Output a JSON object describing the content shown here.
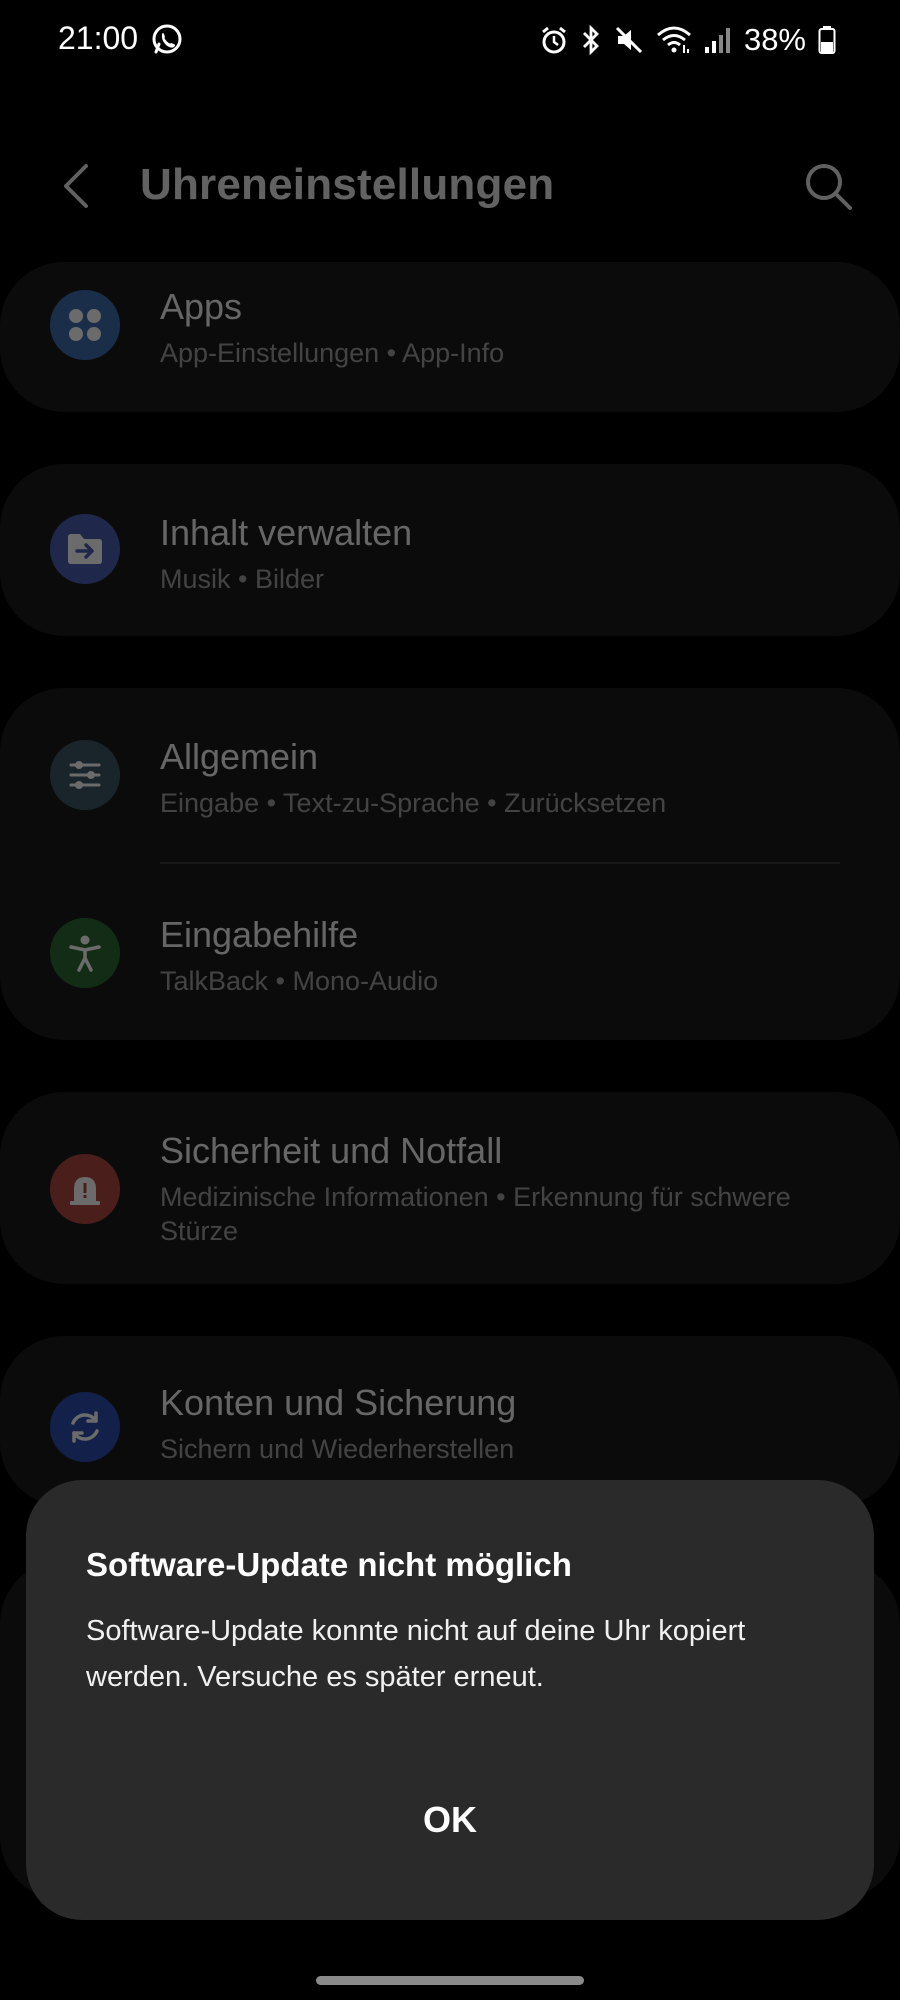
{
  "status_bar": {
    "time": "21:00",
    "battery": "38%",
    "icons": [
      "whatsapp-icon",
      "alarm-icon",
      "bluetooth-icon",
      "mute-icon",
      "wifi-icon",
      "signal-icon",
      "battery-icon"
    ]
  },
  "app_bar": {
    "title": "Uhreneinstellungen",
    "back_icon": "back-arrow-icon",
    "search_icon": "search-icon"
  },
  "settings": [
    {
      "title": "Apps",
      "subtitle": "App-Einstellungen • App-Info",
      "icon": "apps-grid-icon",
      "color": "#3f6fb0"
    },
    {
      "title": "Inhalt verwalten",
      "subtitle": "Musik • Bilder",
      "icon": "folder-transfer-icon",
      "color": "#4a60b0"
    },
    {
      "title": "Allgemein",
      "subtitle": "Eingabe • Text-zu-Sprache • Zurücksetzen",
      "icon": "sliders-icon",
      "color": "#3f5a66"
    },
    {
      "title": "Eingabehilfe",
      "subtitle": "TalkBack • Mono-Audio",
      "icon": "accessibility-icon",
      "color": "#2f6a34"
    },
    {
      "title": "Sicherheit und Notfall",
      "subtitle": "Medizinische Informationen • Erkennung für schwere Stürze",
      "icon": "emergency-siren-icon",
      "color": "#b04a40"
    },
    {
      "title": "Konten und Sicherung",
      "subtitle": "Sichern und Wiederherstellen",
      "icon": "sync-icon",
      "color": "#2f4fb0"
    }
  ],
  "dialog": {
    "title": "Software-Update nicht möglich",
    "message": "Software-Update konnte nicht auf deine Uhr kopiert werden. Versuche es später erneut.",
    "ok_label": "OK"
  }
}
